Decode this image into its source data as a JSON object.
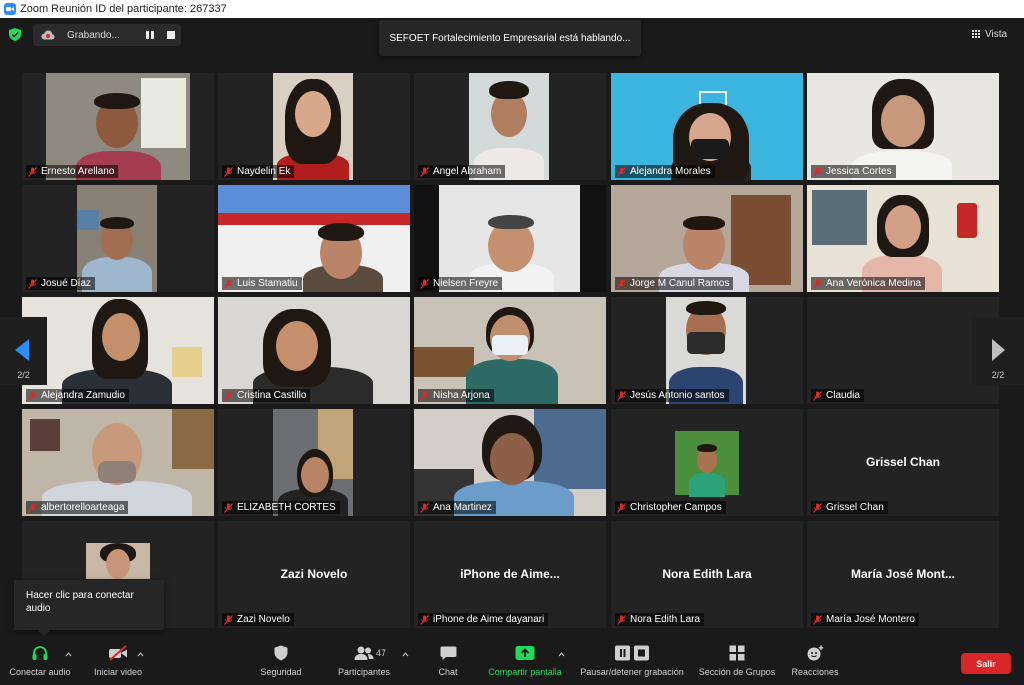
{
  "window": {
    "title": "Zoom Reunión ID del participante: 267337"
  },
  "recording": {
    "label": "Grabando..."
  },
  "banner": {
    "speaking": "SEFOET Fortalecimiento Empresarial está hablando..."
  },
  "view": {
    "label": "Vista"
  },
  "pagination": {
    "left": "2/2",
    "right": "2/2"
  },
  "tooltip": {
    "text": "Hacer clic para conectar audio"
  },
  "participants": [
    {
      "name": "Ernesto Arellano"
    },
    {
      "name": "Naydelin Ek"
    },
    {
      "name": "Angel Abraham"
    },
    {
      "name": "Alejandra Morales"
    },
    {
      "name": "Jessica Cortes"
    },
    {
      "name": "Josué Díaz"
    },
    {
      "name": "Luis Stamatiu"
    },
    {
      "name": "Nielsen Freyre"
    },
    {
      "name": "Jorge M Canul Ramos"
    },
    {
      "name": "Ana Verónica Medina"
    },
    {
      "name": "Alejandra Zamudio"
    },
    {
      "name": "Cristina Castillo"
    },
    {
      "name": "Nisha Arjona"
    },
    {
      "name": "Jesús Antonio santos"
    },
    {
      "name": "Claudia"
    },
    {
      "name": "albertorelloarteaga"
    },
    {
      "name": "ELIZABETH CORTES"
    },
    {
      "name": "Ana Martinez"
    },
    {
      "name": "Christopher Campos"
    },
    {
      "name": "Grissel Chan",
      "display": "Grissel Chan"
    },
    {
      "name": ""
    },
    {
      "name": "Zazi Novelo",
      "display": "Zazi Novelo"
    },
    {
      "name": "iPhone de Aime dayanari",
      "display": "iPhone de Aime..."
    },
    {
      "name": "Nora Edith Lara",
      "display": "Nora Edith Lara"
    },
    {
      "name": "María José Montero",
      "display": "María José Mont..."
    }
  ],
  "toolbar": {
    "audio": "Conectar audio",
    "video": "Iniciar video",
    "security": "Seguridad",
    "participants": "Participantes",
    "participants_count": "47",
    "chat": "Chat",
    "share": "Compartir pantalla",
    "record": "Pausar/detener grabación",
    "breakout": "Sección de Grupos",
    "reactions": "Reacciones",
    "leave": "Salir"
  },
  "colors": {
    "accent": "#2d8cff",
    "share_green": "#23d959",
    "leave_red": "#d92727",
    "muted_red": "#e02828"
  }
}
